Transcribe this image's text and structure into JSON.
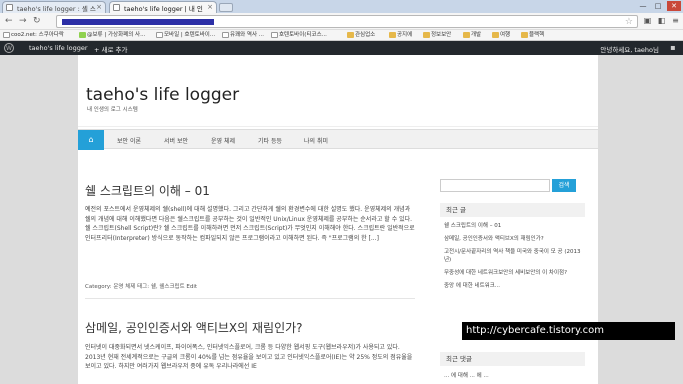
{
  "browser": {
    "tabs": [
      {
        "label": "taeho's life logger : 셸 스"
      },
      {
        "label": "taeho's life logger | 내 인"
      }
    ],
    "window_buttons": [
      "—",
      "□",
      "✕"
    ]
  },
  "bookmarks": [
    {
      "label": "coo2.net: 스쿠아다락",
      "kind": "page"
    },
    {
      "label": "@보류 | 가상화폐의 사...",
      "kind": "page"
    },
    {
      "label": "모바일 | 호텐토바이...",
      "kind": "page"
    },
    {
      "label": "유쾌와 역사 ...",
      "kind": "page"
    },
    {
      "label": "호텐토바이(티코스...",
      "kind": "page"
    },
    {
      "label": "관심업소",
      "kind": "folder"
    },
    {
      "label": "공지에",
      "kind": "folder"
    },
    {
      "label": "정보보안",
      "kind": "folder"
    },
    {
      "label": "개발",
      "kind": "folder"
    },
    {
      "label": "여행",
      "kind": "folder"
    },
    {
      "label": "블랙헥",
      "kind": "folder"
    }
  ],
  "adminbar": {
    "site": "taeho's life logger",
    "new": "+ 새로 추가",
    "user": "안녕하세요, taeho님"
  },
  "site": {
    "title": "taeho's life logger",
    "description": "내 인생의 로그 시스템"
  },
  "nav": {
    "home": "⌂",
    "items": [
      "보안 이론",
      "서버 보안",
      "운영 체제",
      "기타 등등",
      "나의 취미"
    ]
  },
  "post1": {
    "title": "쉘 스크립트의 이해 – 01",
    "body": "예전의 포스트에서 운영체제의 쉘(shell)에 대해 설명했다. 그리고 간단하게 쉘의 환경변수에 대한 설명도 했다. 운영체제의 개념과 쉘의 개념에 대해 이해했다면 다음은 쉘스크립트를 공부하는 것이 일반적인 Unix/Linux 운영체제를 공부하는 순서라고 할 수 있다. 쉘 스크립트(Shell Script)란? 쉘 스크립트를 이해하려면 먼저 스크립트(Script)가 무엇인지 이해해야 한다. 스크립트란 일반적으로 인터프리터(Interpreter) 방식으로 동작하는 컴파일되지 않은 프로그램이라고 이해하면 된다. 즉 \"프로그램의 한 [...]",
    "meta_category_label": "Category:",
    "meta_category": "운영 체제",
    "meta_tags_label": "태그:",
    "meta_tags": "쉘, 쉘스크립트",
    "meta_edit": "Edit"
  },
  "post2": {
    "title": "삼메일, 공인인증서와 액티브X의 재림인가?",
    "body": "인터넷이 대중화되면서 넷스케이프, 파이어폭스, 인터넷익스플로어, 크롬 등 다양한 웹서핑 도구(웹브라우저)가 사용되고 있다. 2013년 현재 전세계적으로는 구글의 크롬이 40%를 넘는 점유율을 보이고 있고 인터넷익스플로어(IE)는 약 25% 정도의 점유율을 보이고 있다. 하지만 여러가지 웹브라우저 중에 유독 우리나라에선 IE"
  },
  "sidebar": {
    "search_button": "검색",
    "recent_title": "최근 글",
    "recent_posts": [
      "쉘 스크립트의 이해 – 01",
      "삼메일, 공인인증서와 액티브X의 재림인가?",
      "고전시/문사끝자리의 역사 책을 미국와 중국이 모 공 (2013년)",
      "무중성에 대한 네트워크보안의 세비보안의 이 차이점?",
      "중앙 에 대한 네트워크..."
    ],
    "comments_title": "최근 댓글",
    "comment_snippet": "... 에 대해 ... 에 ..."
  },
  "watermark": "http://cybercafe.tistory.com"
}
